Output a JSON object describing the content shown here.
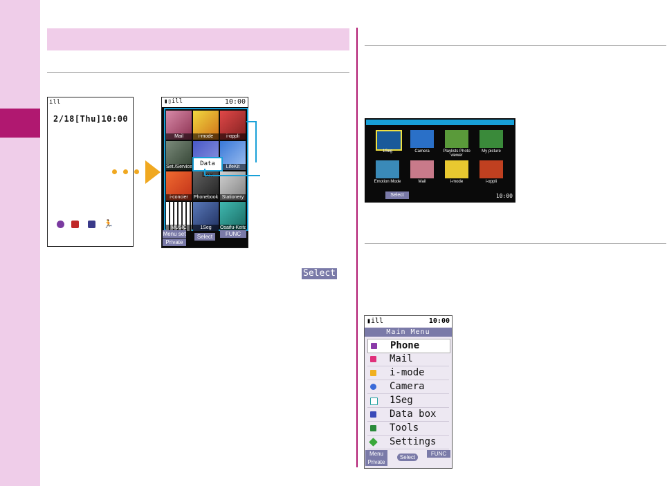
{
  "standby": {
    "signal": "ill",
    "datetime": "2/18[Thu]10:00"
  },
  "menu_grid": {
    "time": "10:00",
    "items": [
      "Mail",
      "i-mode",
      "i-αppli",
      "Set./Service",
      "Data box",
      "LifeKit",
      "i-concier",
      "Phonebook",
      "Stationery",
      "MUSIC",
      "1Seg",
      "Osaifu-Keitai"
    ],
    "softkeys": {
      "menu_set": "Menu set",
      "select": "Select",
      "func": "FUNC",
      "private": "Private"
    }
  },
  "select_badge": "Select",
  "tile_menu": {
    "items": [
      "1Seg",
      "Camera",
      "Playlists Photo viewer",
      "My picture",
      "Emotion Mode",
      "Mail",
      "i-mode",
      "i-αppli"
    ],
    "select": "Select",
    "time": "10:00"
  },
  "list_menu": {
    "status_time": "10:00",
    "title": "Main Menu",
    "items": [
      "Phone",
      "Mail",
      "i-mode",
      "Camera",
      "1Seg",
      "Data box",
      "Tools",
      "Settings"
    ],
    "softkeys": {
      "menu_set": "Menu set",
      "private": "Private",
      "select": "Select",
      "func": "FUNC"
    }
  },
  "colors": {
    "accent": "#b01870",
    "sidebar": "#efcde9",
    "highlight": "#18a0d8",
    "arrow": "#f0a820"
  }
}
